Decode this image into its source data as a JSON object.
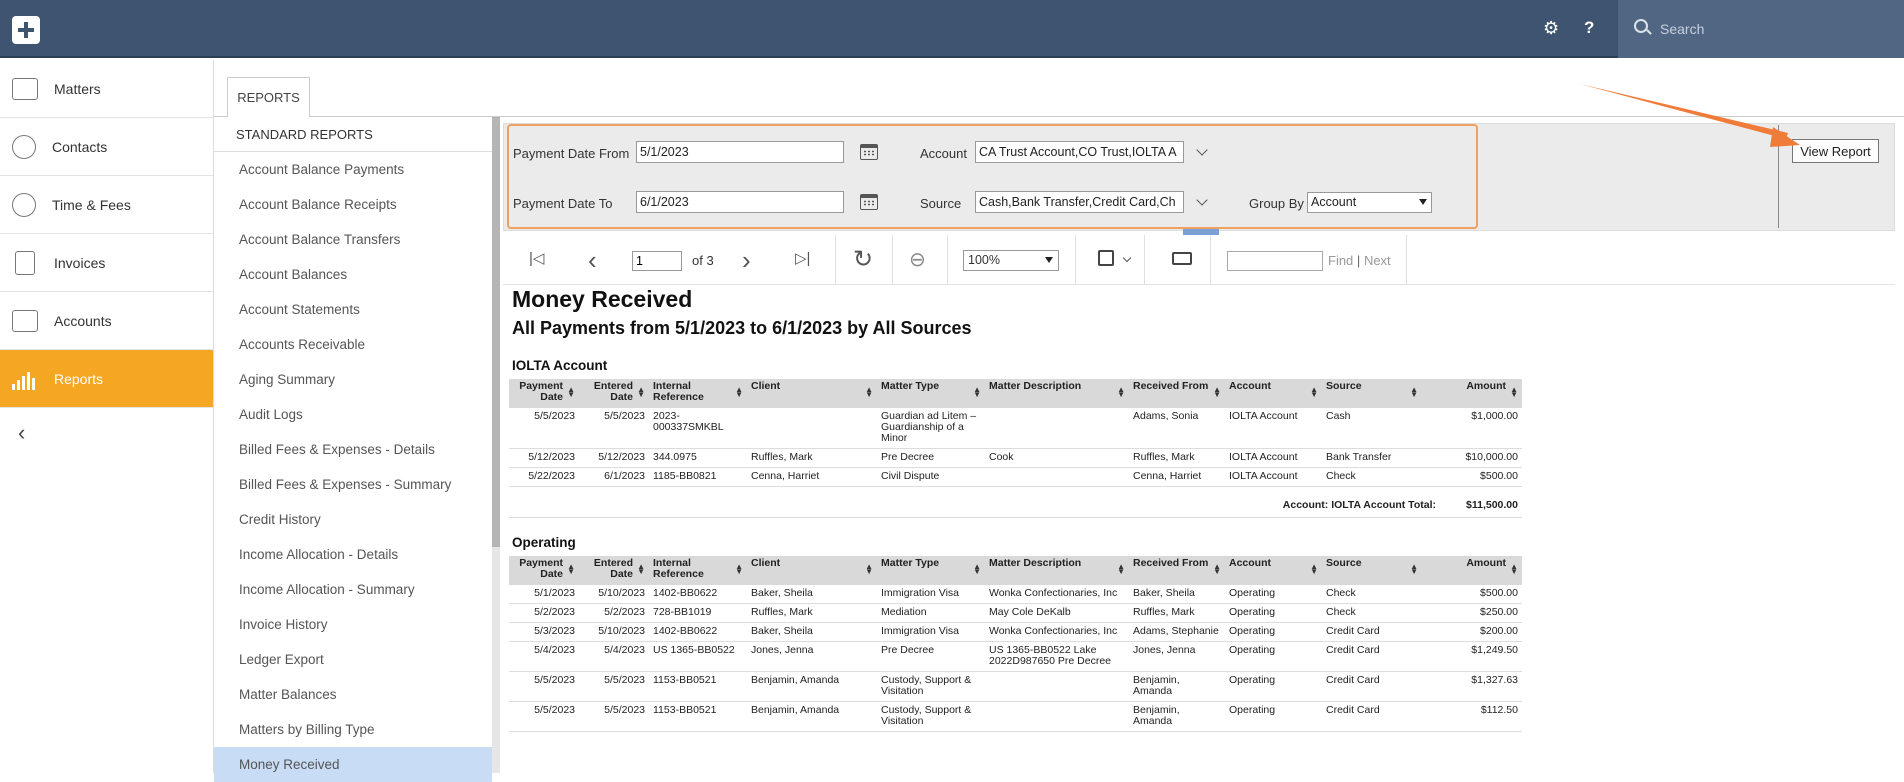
{
  "topbar": {
    "search_placeholder": "Search",
    "help_glyph": "?",
    "gear_glyph": "⚙"
  },
  "nav": {
    "items": [
      {
        "label": "Matters",
        "icon": "matters-icon"
      },
      {
        "label": "Contacts",
        "icon": "contacts-icon"
      },
      {
        "label": "Time & Fees",
        "icon": "clock-icon"
      },
      {
        "label": "Invoices",
        "icon": "invoice-icon"
      },
      {
        "label": "Accounts",
        "icon": "bank-icon"
      },
      {
        "label": "Reports",
        "icon": "bar-chart-icon",
        "active": true
      }
    ],
    "collapse_glyph": "‹"
  },
  "tabs": {
    "reports_label": "REPORTS"
  },
  "report_list": {
    "header": "STANDARD REPORTS",
    "items": [
      "Account Balance Payments",
      "Account Balance Receipts",
      "Account Balance Transfers",
      "Account Balances",
      "Account Statements",
      "Accounts Receivable",
      "Aging Summary",
      "Audit Logs",
      "Billed Fees & Expenses - Details",
      "Billed Fees & Expenses - Summary",
      "Credit History",
      "Income Allocation - Details",
      "Income Allocation - Summary",
      "Invoice History",
      "Ledger Export",
      "Matter Balances",
      "Matters by Billing Type",
      "Money Received"
    ],
    "active_index": 17
  },
  "params": {
    "payment_date_from_label": "Payment Date From",
    "payment_date_from": "5/1/2023",
    "payment_date_to_label": "Payment Date To",
    "payment_date_to": "6/1/2023",
    "account_label": "Account",
    "account_value": "CA Trust Account,CO Trust,IOLTA A",
    "source_label": "Source",
    "source_value": "Cash,Bank Transfer,Credit Card,Ch",
    "group_by_label": "Group By",
    "group_by_value": "Account",
    "view_report_label": "View Report"
  },
  "toolbar": {
    "first_glyph": "|◁",
    "prev_glyph": "‹",
    "page_value": "1",
    "of_pages": "of 3",
    "next_glyph": "›",
    "last_glyph": "▷|",
    "refresh_glyph": "↻",
    "back_glyph": "⊖",
    "zoom_value": "100%",
    "find_label": "Find",
    "sep_label": "|",
    "next_label": "Next"
  },
  "report": {
    "title": "Money Received",
    "subtitle": "All Payments from 5/1/2023 to 6/1/2023 by All Sources",
    "columns": [
      "Payment Date",
      "Entered Date",
      "Internal Reference",
      "Client",
      "Matter Type",
      "Matter Description",
      "Received From",
      "Account",
      "Source",
      "Amount"
    ],
    "groups": [
      {
        "name": "IOLTA Account",
        "rows": [
          [
            "5/5/2023",
            "5/5/2023",
            "2023-000337SMKBL",
            "",
            "Guardian ad Litem – Guardianship of a Minor",
            "",
            "Adams, Sonia",
            "IOLTA Account",
            "Cash",
            "$1,000.00"
          ],
          [
            "5/12/2023",
            "5/12/2023",
            "344.0975",
            "Ruffles, Mark",
            "Pre Decree",
            "Cook",
            "Ruffles, Mark",
            "IOLTA Account",
            "Bank Transfer",
            "$10,000.00"
          ],
          [
            "5/22/2023",
            "6/1/2023",
            "1185-BB0821",
            "Cenna, Harriet",
            "Civil Dispute",
            "",
            "Cenna, Harriet",
            "IOLTA Account",
            "Check",
            "$500.00"
          ]
        ],
        "total_label": "Account: IOLTA Account Total:",
        "total_value": "$11,500.00"
      },
      {
        "name": "Operating",
        "rows": [
          [
            "5/1/2023",
            "5/10/2023",
            "1402-BB0622",
            "Baker, Sheila",
            "Immigration Visa",
            "Wonka Confectionaries, Inc",
            "Baker, Sheila",
            "Operating",
            "Check",
            "$500.00"
          ],
          [
            "5/2/2023",
            "5/2/2023",
            "728-BB1019",
            "Ruffles, Mark",
            "Mediation",
            "May Cole DeKalb",
            "Ruffles, Mark",
            "Operating",
            "Check",
            "$250.00"
          ],
          [
            "5/3/2023",
            "5/10/2023",
            "1402-BB0622",
            "Baker, Sheila",
            "Immigration Visa",
            "Wonka Confectionaries, Inc",
            "Adams, Stephanie",
            "Operating",
            "Credit Card",
            "$200.00"
          ],
          [
            "5/4/2023",
            "5/4/2023",
            "US 1365-BB0522",
            "Jones, Jenna",
            "Pre Decree",
            "US 1365-BB0522 Lake 2022D987650 Pre Decree",
            "Jones, Jenna",
            "Operating",
            "Credit Card",
            "$1,249.50"
          ],
          [
            "5/5/2023",
            "5/5/2023",
            "1153-BB0521",
            "Benjamin, Amanda",
            "Custody, Support & Visitation",
            "",
            "Benjamin, Amanda",
            "Operating",
            "Credit Card",
            "$1,327.63"
          ],
          [
            "5/5/2023",
            "5/5/2023",
            "1153-BB0521",
            "Benjamin, Amanda",
            "Custody, Support & Visitation",
            "",
            "Benjamin, Amanda",
            "Operating",
            "Credit Card",
            "$112.50"
          ]
        ]
      }
    ]
  },
  "colors": {
    "topbar": "#3e5470",
    "accent": "#f5a623",
    "highlight": "#f0a060",
    "selected": "#c8dcf5"
  }
}
